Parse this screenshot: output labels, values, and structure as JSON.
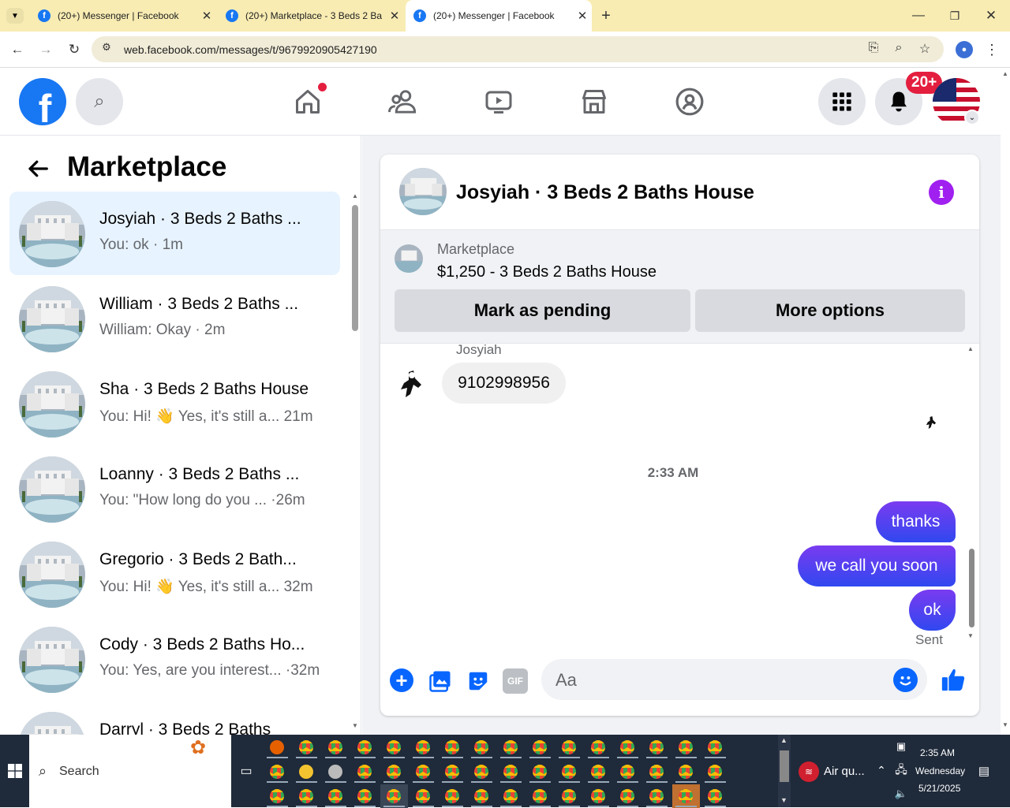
{
  "browser": {
    "tabs": [
      {
        "title": "(20+) Messenger | Facebook",
        "active": false
      },
      {
        "title": "(20+) Marketplace - 3 Beds 2 Ba",
        "active": false
      },
      {
        "title": "(20+) Messenger | Facebook",
        "active": true
      }
    ],
    "url": "web.facebook.com/messages/t/9679920905427190"
  },
  "header": {
    "notifications_badge": "20+",
    "brand_color": "#1877f2"
  },
  "sidebar": {
    "title": "Marketplace",
    "conversations": [
      {
        "name": "Josyiah · 3 Beds 2 Baths ...",
        "preview": "You: ok · 1m",
        "selected": true
      },
      {
        "name": "William · 3 Beds 2 Baths ...",
        "preview": "William: Okay · 2m",
        "selected": false
      },
      {
        "name": "Sha · 3 Beds 2 Baths House",
        "preview": "You: Hi! 👋 Yes, it's still a...  21m",
        "selected": false
      },
      {
        "name": "Loanny · 3 Beds 2 Baths ...",
        "preview": "You: \"How long do you ...  ·26m",
        "selected": false
      },
      {
        "name": "Gregorio · 3 Beds 2 Bath...",
        "preview": "You: Hi! 👋 Yes, it's still a...  32m",
        "selected": false
      },
      {
        "name": "Cody · 3 Beds 2 Baths Ho...",
        "preview": "You: Yes, are you interest... ·32m",
        "selected": false
      },
      {
        "name": "Darryl · 3 Beds 2 Baths",
        "preview": "",
        "selected": false
      }
    ]
  },
  "chat": {
    "title": "Josyiah · 3 Beds 2 Baths House",
    "listing_label": "Marketplace",
    "listing_detail": "$1,250 - 3 Beds 2 Baths House",
    "mark_pending": "Mark as pending",
    "more_options": "More options",
    "sender_name": "Josyiah",
    "incoming_message": "9102998956",
    "timestamp": "2:33 AM",
    "outgoing_messages": [
      "thanks",
      "we call you soon",
      "ok"
    ],
    "status": "Sent",
    "composer_placeholder": "Aa",
    "accent_color": "#3b3ae8"
  },
  "taskbar": {
    "search_label": "Search",
    "weather": "Air qu...",
    "time": "2:35 AM",
    "day": "Wednesday",
    "date": "5/21/2025"
  }
}
